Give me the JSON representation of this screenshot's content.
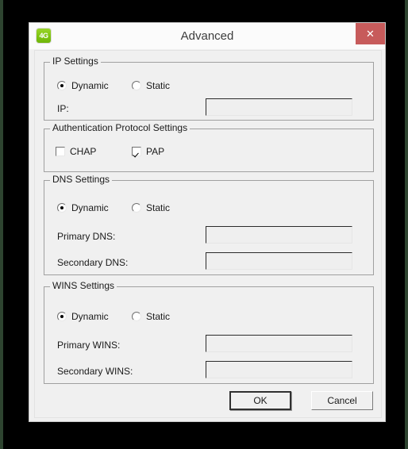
{
  "window": {
    "title": "Advanced",
    "icon": "4G",
    "icon_name": "4g-signal-icon",
    "close_label": "✕",
    "accent_close": "#c75b5b",
    "accent_icon": "#7ec410"
  },
  "groups": {
    "ip": {
      "title": "IP Settings",
      "radios": [
        {
          "label": "Dynamic",
          "checked": true
        },
        {
          "label": "Static",
          "checked": false
        }
      ],
      "fields": [
        {
          "label": "IP:",
          "value": "",
          "placeholder": ""
        }
      ]
    },
    "auth": {
      "title": "Authentication Protocol Settings",
      "checkboxes": [
        {
          "label": "CHAP",
          "checked": false
        },
        {
          "label": "PAP",
          "checked": true
        }
      ]
    },
    "dns": {
      "title": "DNS Settings",
      "radios": [
        {
          "label": "Dynamic",
          "checked": true
        },
        {
          "label": "Static",
          "checked": false
        }
      ],
      "fields": [
        {
          "label": "Primary DNS:",
          "value": "",
          "placeholder": ""
        },
        {
          "label": "Secondary DNS:",
          "value": "",
          "placeholder": ""
        }
      ]
    },
    "wins": {
      "title": "WINS Settings",
      "radios": [
        {
          "label": "Dynamic",
          "checked": true
        },
        {
          "label": "Static",
          "checked": false
        }
      ],
      "fields": [
        {
          "label": "Primary WINS:",
          "value": "",
          "placeholder": ""
        },
        {
          "label": "Secondary WINS:",
          "value": "",
          "placeholder": ""
        }
      ]
    }
  },
  "footer": {
    "ok_label": "OK",
    "cancel_label": "Cancel"
  }
}
